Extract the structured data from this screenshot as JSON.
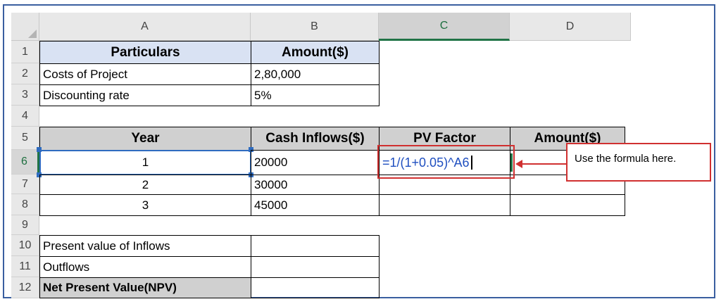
{
  "columns": [
    "A",
    "B",
    "C",
    "D"
  ],
  "rows": [
    "1",
    "2",
    "3",
    "4",
    "5",
    "6",
    "7",
    "8",
    "9",
    "10",
    "11",
    "12"
  ],
  "cells": {
    "A1": "Particulars",
    "B1": "Amount($)",
    "A2": "Costs of Project",
    "B2": "2,80,000",
    "A3": "Discounting rate",
    "B3": "5%",
    "A5": "Year",
    "B5": "Cash Inflows($)",
    "C5": "PV Factor",
    "D5": "Amount($)",
    "A6": "1",
    "B6": "20000",
    "C6": "=1/(1+0.05)^A6",
    "A7": "2",
    "B7": "30000",
    "A8": "3",
    "B8": "45000",
    "A10": "Present value of Inflows",
    "A11": "Outflows",
    "A12": "Net Present Value(NPV)"
  },
  "callout": "Use the formula here.",
  "selected_column": "C",
  "selected_row": "6",
  "colors": {
    "accent": "#217346",
    "annotation": "#d03030",
    "header_fill": "#d9e2f3",
    "formula_text": "#1f4fc0"
  }
}
